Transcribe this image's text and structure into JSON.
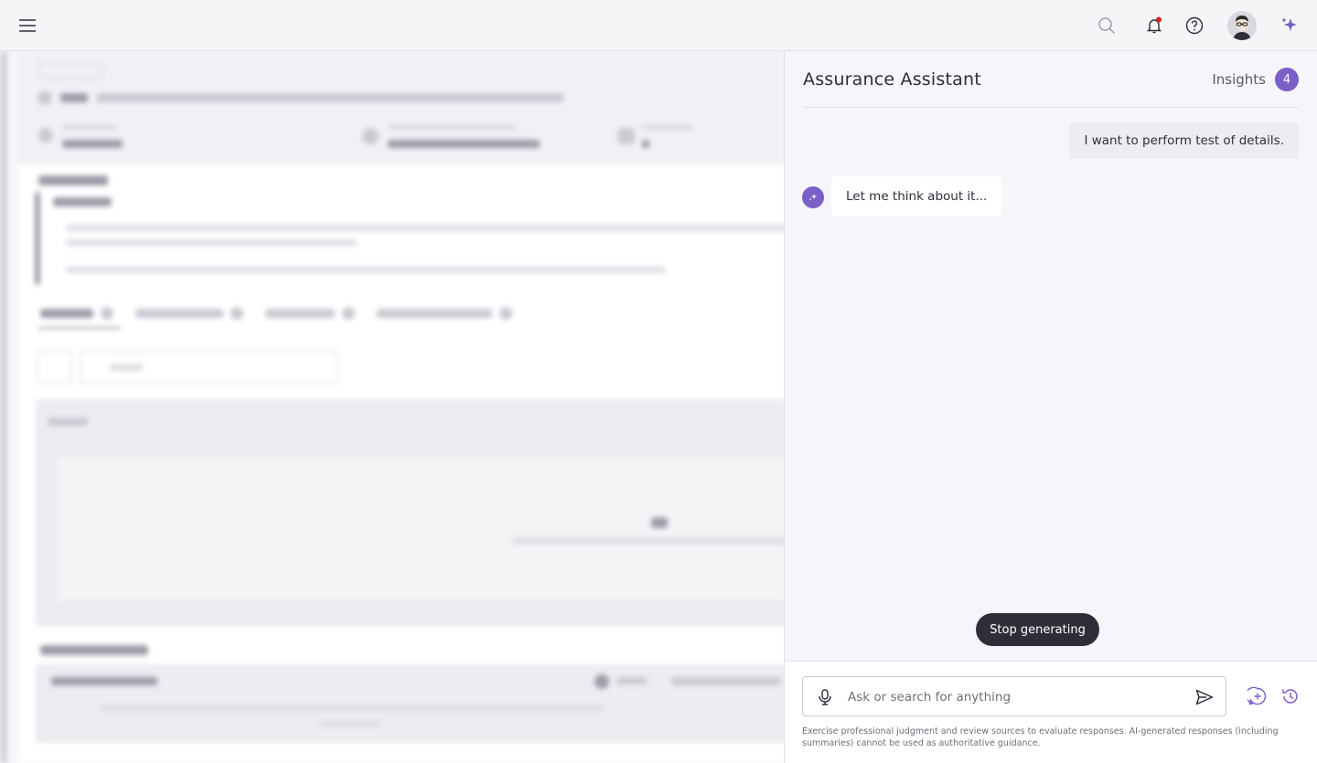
{
  "topbar": {
    "icons": [
      "menu-icon",
      "search-icon",
      "bell-icon",
      "help-icon",
      "avatar",
      "sparkle-icon"
    ],
    "colors": {
      "accent": "#7a5fc7",
      "notification": "#d72020"
    }
  },
  "assistant": {
    "title": "Assurance Assistant",
    "insights_label": "Insights",
    "insights_count": "4",
    "messages": [
      {
        "role": "user",
        "text": "I want to perform test of details."
      },
      {
        "role": "assistant",
        "text": "Let me think about it..."
      }
    ],
    "stop_label": "Stop generating",
    "input_placeholder": "Ask or search for anything",
    "disclaimer": "Exercise professional judgment and review sources to evaluate responses. AI-generated responses (including summaries) cannot be used as authoritative guidance."
  }
}
